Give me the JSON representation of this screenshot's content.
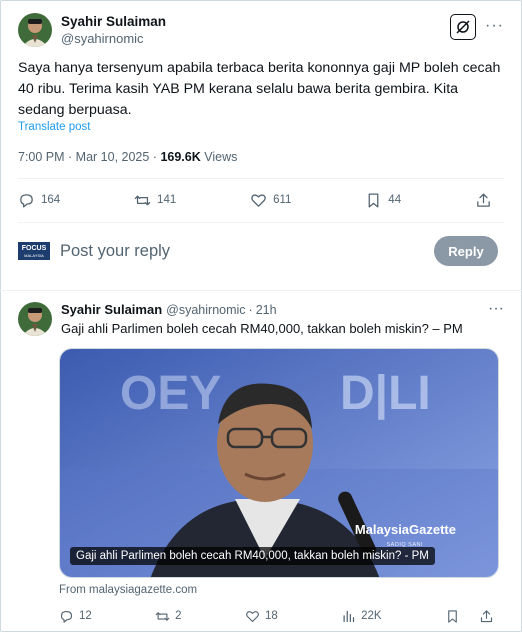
{
  "main_tweet": {
    "author_name": "Syahir Sulaiman",
    "author_handle": "@syahirnomic",
    "text": "Saya hanya tersenyum apabila terbaca berita kononnya gaji MP boleh cecah 40 ribu. Terima kasih YAB PM kerana selalu bawa berita gembira. Kita sedang berpuasa.",
    "translate_label": "Translate post",
    "timestamp": "7:00 PM · Mar 10, 2025 · ",
    "views_count": "169.6K",
    "views_label": " Views",
    "replies": "164",
    "reposts": "141",
    "likes": "611",
    "bookmarks": "44",
    "more_glyph": "···"
  },
  "composer": {
    "avatar_text": "FOCUS",
    "avatar_sub": "MALAYSIA",
    "placeholder": "Post your reply",
    "reply_button": "Reply"
  },
  "reply_tweet": {
    "author_name": "Syahir Sulaiman",
    "author_handle": "@syahirnomic",
    "dot": "·",
    "time": "21h",
    "text": "Gaji ahli Parlimen boleh cecah RM40,000, takkan boleh miskin? – PM",
    "card_caption": "Gaji ahli Parlimen boleh cecah RM40,000, takkan boleh miskin? - PM",
    "card_brand": "MalaysiaGazette",
    "card_brand_sub": "SADIQ SANI",
    "card_source": "From malaysiagazette.com",
    "replies": "12",
    "reposts": "2",
    "likes": "18",
    "views": "22K",
    "more_glyph": "···"
  },
  "colors": {
    "accent": "#1d9bf0",
    "secondary_text": "#536471",
    "reply_button_bg": "#8b98a5"
  }
}
